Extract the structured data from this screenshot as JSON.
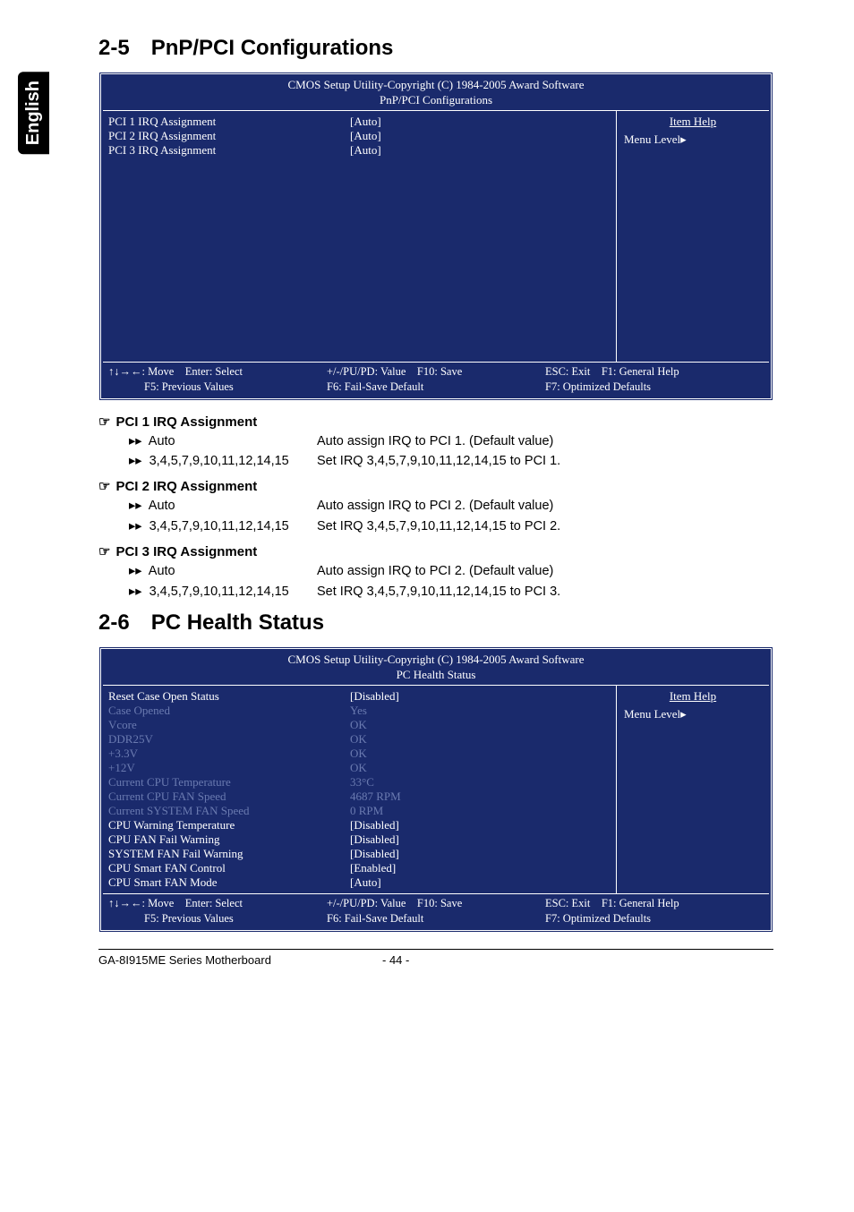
{
  "sideTab": "English",
  "section1": {
    "num": "2-5",
    "title": "PnP/PCI Configurations"
  },
  "section2": {
    "num": "2-6",
    "title": "PC Health Status"
  },
  "bios": {
    "copyright": "CMOS Setup Utility-Copyright (C) 1984-2005 Award Software",
    "itemHelp": "Item Help",
    "menuLevel": "Menu Level",
    "menuArrow": "▸",
    "foot": {
      "c1a": "↑↓→←: Move",
      "c1b": "Enter: Select",
      "c1c": "F5: Previous Values",
      "c2a": "+/-/PU/PD: Value",
      "c2b": "F10: Save",
      "c2c": "F6: Fail-Save Default",
      "c3a": "ESC: Exit",
      "c3b": "F1: General Help",
      "c3c": "F7: Optimized Defaults"
    }
  },
  "bios1": {
    "subtitle": "PnP/PCI Configurations",
    "rows": [
      {
        "label": "PCI 1 IRQ Assignment",
        "val": "[Auto]",
        "dim": false
      },
      {
        "label": "PCI 2 IRQ Assignment",
        "val": "[Auto]",
        "dim": false
      },
      {
        "label": "PCI 3 IRQ Assignment",
        "val": "[Auto]",
        "dim": false
      }
    ]
  },
  "bios2": {
    "subtitle": "PC Health Status",
    "rows": [
      {
        "label": "Reset Case Open Status",
        "val": "[Disabled]",
        "dim": false
      },
      {
        "label": "Case Opened",
        "val": "Yes",
        "dim": true
      },
      {
        "label": "Vcore",
        "val": "OK",
        "dim": true
      },
      {
        "label": "DDR25V",
        "val": "OK",
        "dim": true
      },
      {
        "label": "+3.3V",
        "val": "OK",
        "dim": true
      },
      {
        "label": "+12V",
        "val": "OK",
        "dim": true
      },
      {
        "label": "Current CPU Temperature",
        "val": "33°C",
        "dim": true
      },
      {
        "label": "Current CPU FAN Speed",
        "val": "4687 RPM",
        "dim": true
      },
      {
        "label": "Current SYSTEM FAN Speed",
        "val": "0      RPM",
        "dim": true
      },
      {
        "label": "CPU Warning Temperature",
        "val": "[Disabled]",
        "dim": false
      },
      {
        "label": "CPU FAN Fail Warning",
        "val": "[Disabled]",
        "dim": false
      },
      {
        "label": "SYSTEM FAN Fail Warning",
        "val": "[Disabled]",
        "dim": false
      },
      {
        "label": "CPU Smart FAN Control",
        "val": "[Enabled]",
        "dim": false
      },
      {
        "label": "CPU Smart FAN Mode",
        "val": "[Auto]",
        "dim": false
      }
    ]
  },
  "opts": [
    {
      "head": "PCI 1 IRQ Assignment",
      "rows": [
        {
          "k": "Auto",
          "d": "Auto assign IRQ to PCI 1. (Default value)"
        },
        {
          "k": "3,4,5,7,9,10,11,12,14,15",
          "d": "Set IRQ 3,4,5,7,9,10,11,12,14,15 to PCI 1."
        }
      ]
    },
    {
      "head": "PCI 2 IRQ Assignment",
      "rows": [
        {
          "k": "Auto",
          "d": "Auto assign IRQ to PCI 2. (Default value)"
        },
        {
          "k": "3,4,5,7,9,10,11,12,14,15",
          "d": "Set IRQ 3,4,5,7,9,10,11,12,14,15 to PCI 2."
        }
      ]
    },
    {
      "head": "PCI 3 IRQ Assignment",
      "rows": [
        {
          "k": "Auto",
          "d": "Auto assign IRQ to PCI 2. (Default value)"
        },
        {
          "k": "3,4,5,7,9,10,11,12,14,15",
          "d": "Set IRQ 3,4,5,7,9,10,11,12,14,15 to PCI 3."
        }
      ]
    }
  ],
  "footer": {
    "left": "GA-8I915ME Series Motherboard",
    "center": "- 44 -"
  },
  "glyphs": {
    "hand": "☞",
    "dbl": "▸▸"
  }
}
